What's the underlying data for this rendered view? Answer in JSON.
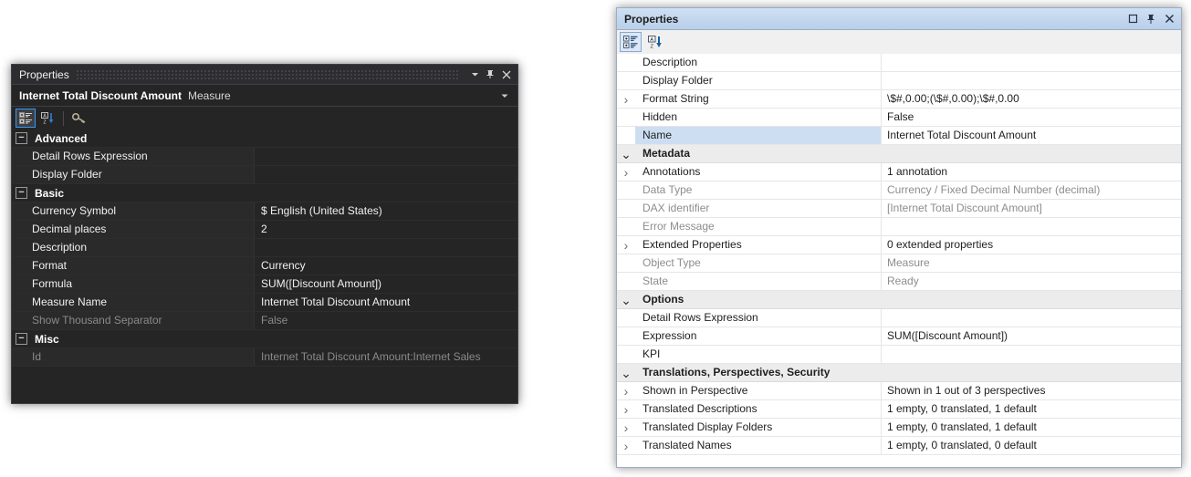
{
  "dark_panel": {
    "title": "Properties",
    "window_buttons": [
      {
        "name": "dropdown-icon",
        "glyph": "▼"
      },
      {
        "name": "pin-icon",
        "glyph": "pin"
      },
      {
        "name": "close-icon",
        "glyph": "✕"
      }
    ],
    "object_header": {
      "name": "Internet Total Discount Amount",
      "type": "Measure",
      "dropdown_glyph": "▾"
    },
    "toolbar": [
      {
        "name": "categorized-view-icon",
        "selected": true
      },
      {
        "name": "alphabetical-sort-icon",
        "selected": false
      },
      {
        "name": "property-pages-key-icon",
        "selected": false
      }
    ],
    "rows": [
      {
        "kind": "category",
        "label": "Advanced",
        "expanded": true
      },
      {
        "kind": "prop",
        "name": "Detail Rows Expression",
        "value": "",
        "disabled": false
      },
      {
        "kind": "prop",
        "name": "Display Folder",
        "value": "",
        "disabled": false
      },
      {
        "kind": "category",
        "label": "Basic",
        "expanded": true
      },
      {
        "kind": "prop",
        "name": "Currency Symbol",
        "value": "$ English (United States)",
        "disabled": false
      },
      {
        "kind": "prop",
        "name": "Decimal places",
        "value": "2",
        "disabled": false
      },
      {
        "kind": "prop",
        "name": "Description",
        "value": "",
        "disabled": false
      },
      {
        "kind": "prop",
        "name": "Format",
        "value": "Currency",
        "disabled": false
      },
      {
        "kind": "prop",
        "name": "Formula",
        "value": "SUM([Discount Amount])",
        "disabled": false
      },
      {
        "kind": "prop",
        "name": "Measure Name",
        "value": "Internet Total Discount Amount",
        "disabled": false
      },
      {
        "kind": "prop",
        "name": "Show Thousand Separator",
        "value": "False",
        "disabled": true
      },
      {
        "kind": "category",
        "label": "Misc",
        "expanded": true
      },
      {
        "kind": "prop",
        "name": "Id",
        "value": "Internet Total Discount Amount:Internet Sales",
        "disabled": true
      }
    ]
  },
  "light_panel": {
    "title": "Properties",
    "window_buttons": [
      {
        "name": "maximize-icon",
        "glyph": "□"
      },
      {
        "name": "pin-icon",
        "glyph": "pin"
      },
      {
        "name": "close-icon",
        "glyph": "✕"
      }
    ],
    "toolbar": [
      {
        "name": "categorized-view-icon",
        "selected": true
      },
      {
        "name": "alphabetical-sort-icon",
        "selected": false
      }
    ],
    "rows": [
      {
        "kind": "prop",
        "name": "Description",
        "value": "",
        "expander": "",
        "disabled": false,
        "selected": false,
        "strong": false
      },
      {
        "kind": "prop",
        "name": "Display Folder",
        "value": "",
        "expander": "",
        "disabled": false,
        "selected": false,
        "strong": false
      },
      {
        "kind": "prop",
        "name": "Format String",
        "value": "\\$#,0.00;(\\$#,0.00);\\$#,0.00",
        "expander": "collapsed",
        "disabled": false,
        "selected": false,
        "strong": false
      },
      {
        "kind": "prop",
        "name": "Hidden",
        "value": "False",
        "expander": "",
        "disabled": false,
        "selected": false,
        "strong": false
      },
      {
        "kind": "prop",
        "name": "Name",
        "value": "Internet Total Discount Amount",
        "expander": "",
        "disabled": false,
        "selected": true,
        "strong": false
      },
      {
        "kind": "category",
        "name": "Metadata",
        "value": "",
        "expander": "expanded",
        "disabled": false,
        "selected": false,
        "strong": true
      },
      {
        "kind": "prop",
        "name": "Annotations",
        "value": "1 annotation",
        "expander": "collapsed",
        "disabled": false,
        "selected": false,
        "strong": false
      },
      {
        "kind": "prop",
        "name": "Data Type",
        "value": "Currency / Fixed Decimal Number (decimal)",
        "expander": "",
        "disabled": true,
        "selected": false,
        "strong": false
      },
      {
        "kind": "prop",
        "name": "DAX identifier",
        "value": "[Internet Total Discount Amount]",
        "expander": "",
        "disabled": true,
        "selected": false,
        "strong": false
      },
      {
        "kind": "prop",
        "name": "Error Message",
        "value": "",
        "expander": "",
        "disabled": true,
        "selected": false,
        "strong": false
      },
      {
        "kind": "prop",
        "name": "Extended Properties",
        "value": "0 extended properties",
        "expander": "collapsed",
        "disabled": false,
        "selected": false,
        "strong": false
      },
      {
        "kind": "prop",
        "name": "Object Type",
        "value": "Measure",
        "expander": "",
        "disabled": true,
        "selected": false,
        "strong": false
      },
      {
        "kind": "prop",
        "name": "State",
        "value": "Ready",
        "expander": "",
        "disabled": true,
        "selected": false,
        "strong": false
      },
      {
        "kind": "category",
        "name": "Options",
        "value": "",
        "expander": "expanded",
        "disabled": false,
        "selected": false,
        "strong": true
      },
      {
        "kind": "prop",
        "name": "Detail Rows Expression",
        "value": "",
        "expander": "",
        "disabled": false,
        "selected": false,
        "strong": false
      },
      {
        "kind": "prop",
        "name": "Expression",
        "value": "SUM([Discount Amount])",
        "expander": "",
        "disabled": false,
        "selected": false,
        "strong": false
      },
      {
        "kind": "prop",
        "name": "KPI",
        "value": "",
        "expander": "",
        "disabled": false,
        "selected": false,
        "strong": false
      },
      {
        "kind": "category",
        "name": "Translations, Perspectives, Security",
        "value": "",
        "expander": "expanded",
        "disabled": false,
        "selected": false,
        "strong": true
      },
      {
        "kind": "prop",
        "name": "Shown in Perspective",
        "value": "Shown in 1 out of 3 perspectives",
        "expander": "collapsed",
        "disabled": false,
        "selected": false,
        "strong": false
      },
      {
        "kind": "prop",
        "name": "Translated Descriptions",
        "value": "1 empty, 0 translated, 1 default",
        "expander": "collapsed",
        "disabled": false,
        "selected": false,
        "strong": false
      },
      {
        "kind": "prop",
        "name": "Translated Display Folders",
        "value": "1 empty, 0 translated, 1 default",
        "expander": "collapsed",
        "disabled": false,
        "selected": false,
        "strong": false
      },
      {
        "kind": "prop",
        "name": "Translated Names",
        "value": "1 empty, 0 translated, 0 default",
        "expander": "collapsed",
        "disabled": false,
        "selected": false,
        "strong": false
      }
    ]
  },
  "colors": {
    "dark_bg": "#252526",
    "dark_chrome": "#2d2d30",
    "dark_border": "#3f3f46",
    "accent_blue": "#3399ff",
    "light_title_bg": "#c3d7ee",
    "light_selection": "#cddef3",
    "light_category_bg": "#ececec"
  }
}
